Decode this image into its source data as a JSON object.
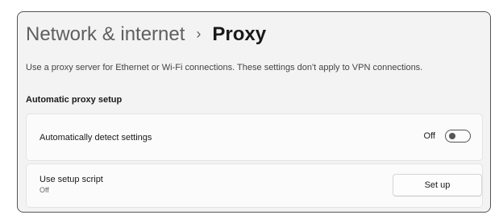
{
  "header": {
    "parent": "Network & internet",
    "separator": "›",
    "current": "Proxy"
  },
  "description": "Use a proxy server for Ethernet or Wi-Fi connections. These settings don't apply to VPN connections.",
  "automatic_proxy": {
    "section_title": "Automatic proxy setup",
    "detect": {
      "label": "Automatically detect settings",
      "state_label": "Off",
      "enabled": false
    },
    "script": {
      "label": "Use setup script",
      "sublabel": "Off",
      "button_label": "Set up"
    }
  }
}
